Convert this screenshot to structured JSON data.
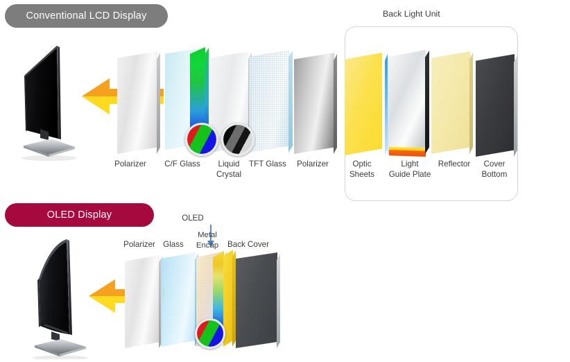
{
  "sections": {
    "lcd": {
      "badge": "Conventional LCD Display",
      "badge_color": "#7d7d7d",
      "tv_name": "conventional-flat-lcd-tv",
      "layers": [
        {
          "id": "polarizer-front",
          "label": "Polarizer"
        },
        {
          "id": "cf-glass",
          "label": "C/F Glass"
        },
        {
          "id": "liquid-crystal",
          "label": "Liquid\nCrystal"
        },
        {
          "id": "tft-glass",
          "label": "TFT Glass"
        },
        {
          "id": "polarizer-rear",
          "label": "Polarizer"
        },
        {
          "id": "optic-sheets",
          "label": "Optic\nSheets"
        },
        {
          "id": "light-guide-plate",
          "label": "Light\nGuide Plate"
        },
        {
          "id": "reflector",
          "label": "Reflector"
        },
        {
          "id": "cover-bottom",
          "label": "Cover\nBottom"
        }
      ],
      "backlight_group": {
        "title": "Back Light Unit",
        "members": [
          "Optic Sheets",
          "Light Guide Plate",
          "Reflector",
          "Cover Bottom"
        ]
      },
      "callouts": [
        {
          "id": "cf-glass-rgb-circle",
          "depicts": "rgb-color-filter-stripes"
        },
        {
          "id": "liquid-crystal-gray-circle",
          "depicts": "grayscale-shutter-stripes"
        }
      ]
    },
    "oled": {
      "badge": "OLED Display",
      "badge_color": "#a6093d",
      "tv_name": "curved-oled-tv",
      "layers": [
        {
          "id": "oled-polarizer",
          "label": "Polarizer"
        },
        {
          "id": "oled-glass",
          "label": "Glass"
        },
        {
          "id": "oled-emissive",
          "label": "OLED"
        },
        {
          "id": "oled-metal-encap",
          "label": "Metal\nEncap"
        },
        {
          "id": "oled-back-cover",
          "label": "Back Cover"
        }
      ],
      "callouts": [
        {
          "id": "oled-rgb-circle",
          "depicts": "rgb-self-emissive-stripes"
        }
      ]
    }
  },
  "colors": {
    "light_arrow_top": "#F5A01E",
    "light_arrow_bottom": "#FFDA1F",
    "oled_pointer": "#4a7fc1",
    "label_text": "#3c3c3c",
    "bracket_outline": "#d2d6da",
    "reflector": "#f4eab4",
    "cover_bottom": "#3a3a3a",
    "optic_sheets": "#fbe54a",
    "background": "#ffffff"
  }
}
